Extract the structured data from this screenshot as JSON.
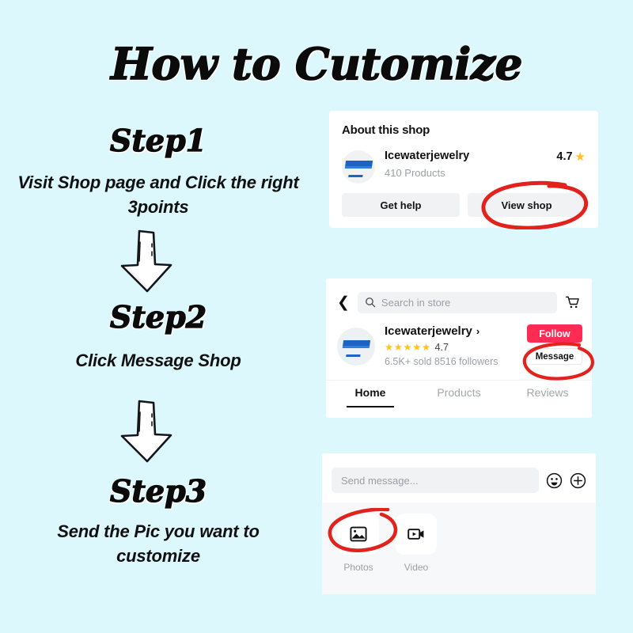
{
  "page": {
    "title": "How to Cutomize",
    "background_color": "#ddf8fd",
    "accent_red": "#e1221d",
    "brand_red": "#fe2c55",
    "star_color": "#ffc221"
  },
  "steps": [
    {
      "heading": "Step1",
      "description": "Visit Shop page and Click the right 3points"
    },
    {
      "heading": "Step2",
      "description": "Click Message Shop"
    },
    {
      "heading": "Step3",
      "description": "Send the Pic you want to customize"
    }
  ],
  "arrows": [
    {
      "name": "down-arrow-1",
      "direction": "down"
    },
    {
      "name": "down-arrow-2",
      "direction": "down"
    }
  ],
  "card_about": {
    "title": "About this shop",
    "shop_name": "Icewaterjewelry",
    "products_count": "410 Products",
    "rating": "4.7",
    "star_glyph": "★",
    "buttons": [
      {
        "label": "Get help",
        "annotated": false
      },
      {
        "label": "View shop",
        "annotated": true
      }
    ]
  },
  "card_shop": {
    "back_icon": "chevron-left-icon",
    "search_placeholder": "Search in store",
    "cart_icon": "cart-icon",
    "shop_name": "Icewaterjewelry",
    "name_chevron": "›",
    "stars_glyph": "★★★★★",
    "rating": "4.7",
    "meta": "6.5K+ sold  8516 followers",
    "follow_label": "Follow",
    "message_label": "Message",
    "tabs": [
      {
        "label": "Home",
        "active": true
      },
      {
        "label": "Products",
        "active": false
      },
      {
        "label": "Reviews",
        "active": false
      }
    ]
  },
  "card_message": {
    "input_placeholder": "Send message...",
    "emoji_icon": "emoji-smiley-icon",
    "plus_icon": "plus-circle-icon",
    "attachments": [
      {
        "label": "Photos",
        "icon": "photo-image-icon",
        "annotated": true
      },
      {
        "label": "Video",
        "icon": "video-camera-icon",
        "annotated": false
      }
    ]
  },
  "annotations": [
    {
      "name": "red-circle-view-shop",
      "target": "View shop"
    },
    {
      "name": "red-circle-message",
      "target": "Message"
    },
    {
      "name": "red-circle-photos",
      "target": "Photos"
    }
  ]
}
